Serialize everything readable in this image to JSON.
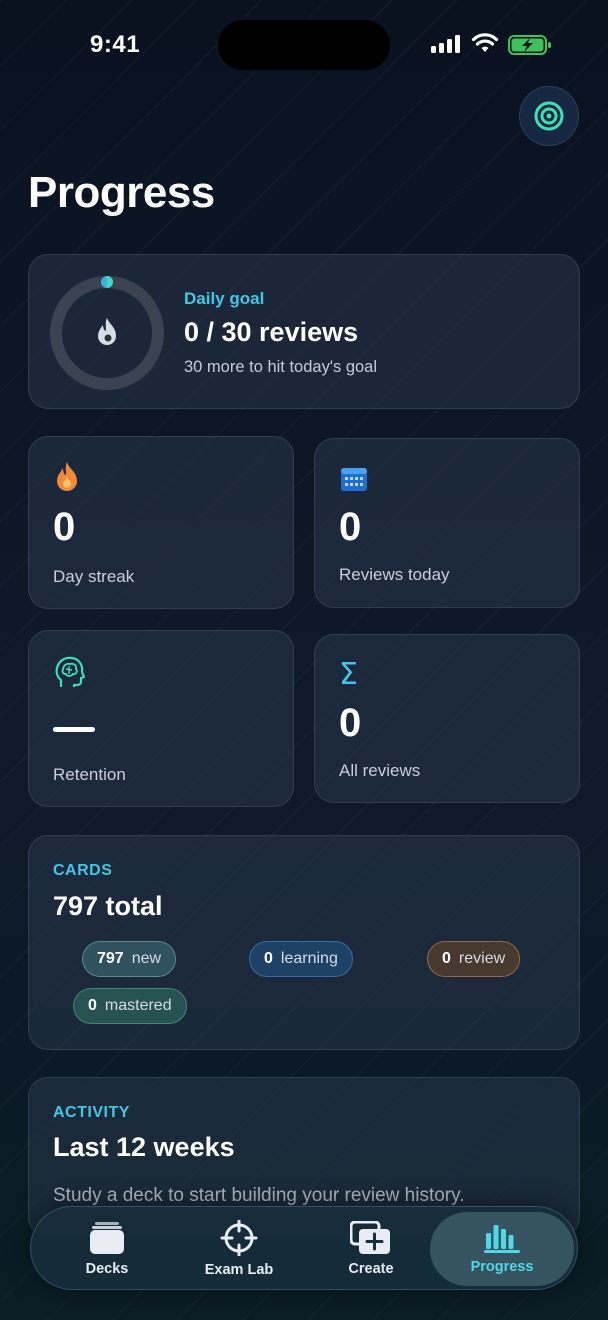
{
  "status_bar": {
    "time": "9:41"
  },
  "header": {
    "title": "Progress"
  },
  "daily_goal": {
    "label": "Daily goal",
    "value": "0 / 30 reviews",
    "subtitle": "30 more to hit today's goal",
    "progress_fraction": 0
  },
  "stats": [
    {
      "value": "0",
      "label": "Day streak",
      "icon": "flame-icon"
    },
    {
      "value": "0",
      "label": "Reviews today",
      "icon": "calendar-icon"
    },
    {
      "value": "—",
      "label": "Retention",
      "icon": "brain-head-icon"
    },
    {
      "value": "0",
      "label": "All reviews",
      "icon": "sigma-icon"
    }
  ],
  "cards": {
    "label": "CARDS",
    "total": "797 total",
    "pills": {
      "new": {
        "count": "797",
        "label": "new"
      },
      "learning": {
        "count": "0",
        "label": "learning"
      },
      "review": {
        "count": "0",
        "label": "review"
      },
      "mastered": {
        "count": "0",
        "label": "mastered"
      }
    }
  },
  "activity": {
    "label": "ACTIVITY",
    "title": "Last 12 weeks",
    "hint": "Study a deck to start building your review history."
  },
  "tabs": [
    {
      "label": "Decks",
      "icon": "decks-icon"
    },
    {
      "label": "Exam Lab",
      "icon": "crosshair-icon"
    },
    {
      "label": "Create",
      "icon": "create-icon"
    },
    {
      "label": "Progress",
      "icon": "bar-chart-icon",
      "active": true
    }
  ],
  "colors": {
    "accent": "#44c7e6",
    "active_tab": "#4fd9e6",
    "flame": "#f08a3a"
  }
}
